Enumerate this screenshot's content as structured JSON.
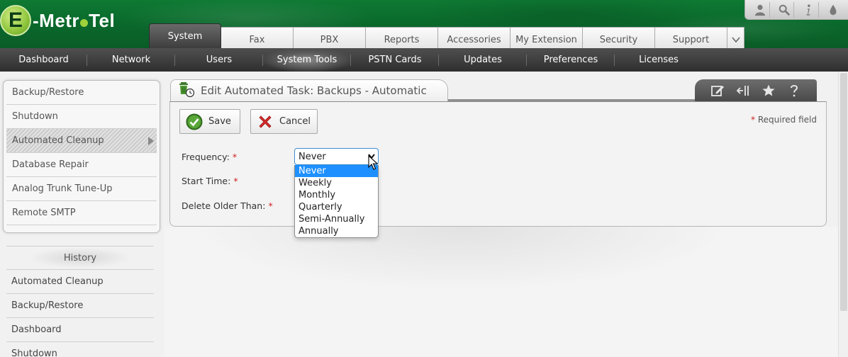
{
  "brand": {
    "logo_letter": "E",
    "logo_part1": "-Metr",
    "logo_part2": "Tel",
    "accent": "#0e7a33"
  },
  "utility_icons": [
    "user-icon",
    "search-icon",
    "info-icon",
    "drop-icon"
  ],
  "main_tabs": [
    {
      "label": "System",
      "active": true
    },
    {
      "label": "Fax",
      "active": false
    },
    {
      "label": "PBX",
      "active": false
    },
    {
      "label": "Reports",
      "active": false
    },
    {
      "label": "Accessories",
      "active": false
    },
    {
      "label": "My Extension",
      "active": false
    },
    {
      "label": "Security",
      "active": false
    },
    {
      "label": "Support",
      "active": false
    }
  ],
  "sub_nav": [
    {
      "label": "Dashboard",
      "active": false
    },
    {
      "label": "Network",
      "active": false
    },
    {
      "label": "Users",
      "active": false
    },
    {
      "label": "System Tools",
      "active": true
    },
    {
      "label": "PSTN Cards",
      "active": false
    },
    {
      "label": "Updates",
      "active": false
    },
    {
      "label": "Preferences",
      "active": false
    },
    {
      "label": "Licenses",
      "active": false
    }
  ],
  "left_menu": [
    {
      "label": "Backup/Restore",
      "active": false
    },
    {
      "label": "Shutdown",
      "active": false
    },
    {
      "label": "Automated Cleanup",
      "active": true
    },
    {
      "label": "Database Repair",
      "active": false
    },
    {
      "label": "Analog Trunk Tune-Up",
      "active": false
    },
    {
      "label": "Remote SMTP",
      "active": false
    }
  ],
  "history": {
    "title": "History",
    "items": [
      "Automated Cleanup",
      "Backup/Restore",
      "Dashboard",
      "Shutdown"
    ]
  },
  "panel": {
    "title": "Edit Automated Task: Backups - Automatic",
    "save_label": "Save",
    "cancel_label": "Cancel",
    "required_note": "Required field",
    "required_star": "*",
    "fields": {
      "frequency": {
        "label": "Frequency:",
        "value": "Never"
      },
      "start_time": {
        "label": "Start Time:"
      },
      "delete_older": {
        "label": "Delete Older Than:"
      }
    },
    "frequency_options": [
      "Never",
      "Weekly",
      "Monthly",
      "Quarterly",
      "Semi-Annually",
      "Annually"
    ],
    "selected_option": "Never"
  }
}
